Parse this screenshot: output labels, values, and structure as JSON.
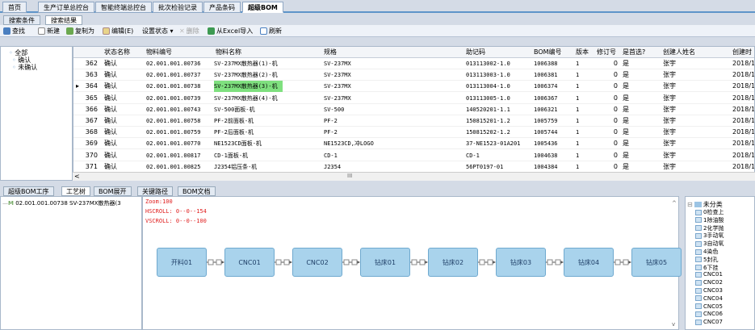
{
  "top_tabs": [
    "首页",
    "生产订单总控台",
    "智能终端总控台",
    "批次检验记录",
    "产品条码",
    "超级BOM"
  ],
  "sub_tabs": [
    "搜索条件",
    "搜索结果"
  ],
  "toolbar": {
    "find": "查找",
    "new": "新建",
    "copy_as": "复制为",
    "edit": "编辑(E)",
    "set_status": "设置状态 ▾",
    "delete": "删除",
    "import_excel": "从Excel导入",
    "refresh": "刷新"
  },
  "tree": [
    "全部",
    "确认",
    "未确认"
  ],
  "columns": [
    "状态名称",
    "物料编号",
    "物料名称",
    "规格",
    "助记码",
    "BOM编号",
    "版本",
    "修订号",
    "是首选?",
    "创建人姓名",
    "创建时"
  ],
  "rows": [
    {
      "n": "362",
      "status": "确认",
      "code": "02.001.001.00736",
      "name": "SV-237MX散热器(1)-机",
      "spec": "SV-237MX",
      "mnem": "013113002-1.0",
      "bom": "1006388",
      "ver": "1",
      "rev": "0",
      "pref": "是",
      "creator": "张宇",
      "time": "2018/1"
    },
    {
      "n": "363",
      "status": "确认",
      "code": "02.001.001.00737",
      "name": "SV-237MX散热器(2)-机",
      "spec": "SV-237MX",
      "mnem": "013113003-1.0",
      "bom": "1006381",
      "ver": "1",
      "rev": "0",
      "pref": "是",
      "creator": "张宇",
      "time": "2018/1"
    },
    {
      "n": "364",
      "status": "确认",
      "code": "02.001.001.00738",
      "name": "SV-237MX散热器(3)-机",
      "spec": "SV-237MX",
      "mnem": "013113004-1.0",
      "bom": "1006374",
      "ver": "1",
      "rev": "0",
      "pref": "是",
      "creator": "张宇",
      "time": "2018/1"
    },
    {
      "n": "365",
      "status": "确认",
      "code": "02.001.001.00739",
      "name": "SV-237MX散热器(4)-机",
      "spec": "SV-237MX",
      "mnem": "013113005-1.0",
      "bom": "1006367",
      "ver": "1",
      "rev": "0",
      "pref": "是",
      "creator": "张宇",
      "time": "2018/1"
    },
    {
      "n": "366",
      "status": "确认",
      "code": "02.001.001.00743",
      "name": "SV-500面板-机",
      "spec": "SV-500",
      "mnem": "140520201-1.1",
      "bom": "1006321",
      "ver": "1",
      "rev": "0",
      "pref": "是",
      "creator": "张宇",
      "time": "2018/1"
    },
    {
      "n": "367",
      "status": "确认",
      "code": "02.001.001.00758",
      "name": "PF-2前面板-机",
      "spec": "PF-2",
      "mnem": "150815201-1.2",
      "bom": "1005759",
      "ver": "1",
      "rev": "0",
      "pref": "是",
      "creator": "张宇",
      "time": "2018/1"
    },
    {
      "n": "368",
      "status": "确认",
      "code": "02.001.001.00759",
      "name": "PF-2后面板-机",
      "spec": "PF-2",
      "mnem": "150815202-1.2",
      "bom": "1005744",
      "ver": "1",
      "rev": "0",
      "pref": "是",
      "creator": "张宇",
      "time": "2018/1"
    },
    {
      "n": "369",
      "status": "确认",
      "code": "02.001.001.00770",
      "name": "NE1523CD面板-机",
      "spec": "NE1523CD,冲LOGO",
      "mnem": "37-NE1523-01A201",
      "bom": "1005436",
      "ver": "1",
      "rev": "0",
      "pref": "是",
      "creator": "张宇",
      "time": "2018/1"
    },
    {
      "n": "370",
      "status": "确认",
      "code": "02.001.001.00817",
      "name": "CD-1面板-机",
      "spec": "CD-1",
      "mnem": "CD-1",
      "bom": "1004638",
      "ver": "1",
      "rev": "0",
      "pref": "是",
      "creator": "张宇",
      "time": "2018/1"
    },
    {
      "n": "371",
      "status": "确认",
      "code": "02.001.001.00825",
      "name": "J2354铝压条-机",
      "spec": "J2354",
      "mnem": "56PT0197-01",
      "bom": "1004384",
      "ver": "1",
      "rev": "0",
      "pref": "是",
      "creator": "张宇",
      "time": "2018/1"
    }
  ],
  "scroll_mark": "III",
  "bottom_tabs": [
    "超级BOM工序",
    "工艺树",
    "BOM展开",
    "关键路径",
    "BOM文档"
  ],
  "left_tree_item": "02.001.001.00738 SV-237MX散热器(3",
  "left_tree_prefix": "M",
  "debug": {
    "zoom": "Zoom:100",
    "hscroll": "HSCROLL: 0--0--154",
    "vscroll": "VSCROLL: 0--0--100"
  },
  "flow": [
    "开料01",
    "CNC01",
    "CNC02",
    "钻床01",
    "钻床02",
    "钻床03",
    "钻床04",
    "钻床05"
  ],
  "right_tree_root": "未分类",
  "right_tree": [
    "0检查上",
    "1除油酸",
    "2化学抛",
    "3手动氧",
    "3自动氧",
    "4染色",
    "5封孔",
    "6下挂",
    "CNC01",
    "CNC02",
    "CNC03",
    "CNC04",
    "CNC05",
    "CNC06",
    "CNC07"
  ],
  "colors": {
    "accent": "#5e94c9",
    "highlight": "#7fe07f",
    "node": "#a9d3ec",
    "red": "#e02020"
  }
}
